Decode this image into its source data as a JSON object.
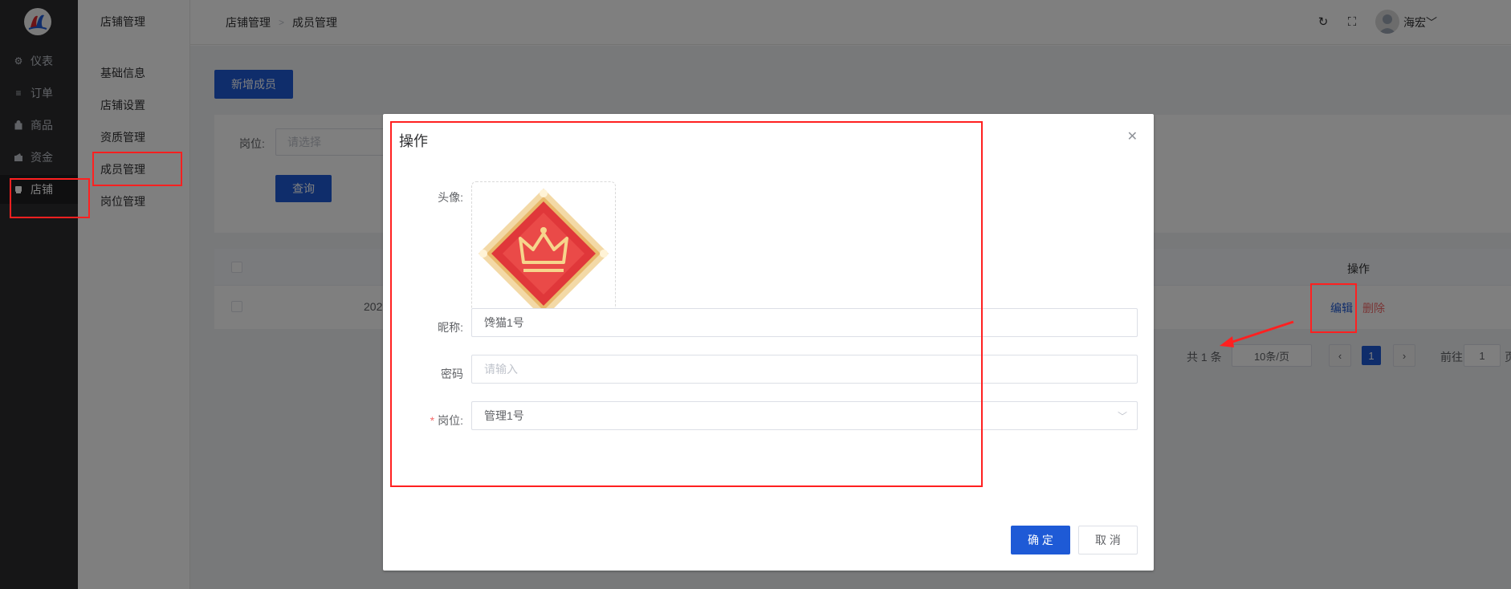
{
  "nav": {
    "items": [
      {
        "label": "仪表",
        "icon": "dashboard-icon"
      },
      {
        "label": "订单",
        "icon": "list-icon"
      },
      {
        "label": "商品",
        "icon": "bag-icon"
      },
      {
        "label": "资金",
        "icon": "wallet-icon"
      },
      {
        "label": "店铺",
        "icon": "shop-icon"
      }
    ],
    "active_index": 4
  },
  "subnav": {
    "title": "店铺管理",
    "items": [
      {
        "label": "基础信息"
      },
      {
        "label": "店铺设置"
      },
      {
        "label": "资质管理"
      },
      {
        "label": "成员管理"
      },
      {
        "label": "岗位管理"
      }
    ],
    "active_index": 3
  },
  "header": {
    "breadcrumb": [
      "店铺管理",
      "成员管理"
    ],
    "username": "海宏"
  },
  "main": {
    "add_button": "新增成员",
    "search": {
      "label": "岗位:",
      "placeholder": "请选择",
      "query_button": "查询"
    },
    "table": {
      "action_header": "操作",
      "row_date_partial": "202",
      "edit_link": "编辑",
      "delete_link": "删除"
    },
    "pagination": {
      "total": "共 1 条",
      "page_size": "10条/页",
      "current_page": "1",
      "goto_label": "前往",
      "goto_value": "1",
      "page_suffix": "页"
    }
  },
  "dialog": {
    "title": "操作",
    "avatar_label": "头像:",
    "nickname_label": "昵称:",
    "nickname_value": "馋猫1号",
    "password_label": "密码",
    "password_placeholder": "请输入",
    "position_label": "岗位:",
    "position_value": "管理1号",
    "ok_button": "确 定",
    "cancel_button": "取 消"
  },
  "colors": {
    "primary": "#1e5ad6",
    "danger": "#f56c6c",
    "annotation": "#ff2020"
  }
}
